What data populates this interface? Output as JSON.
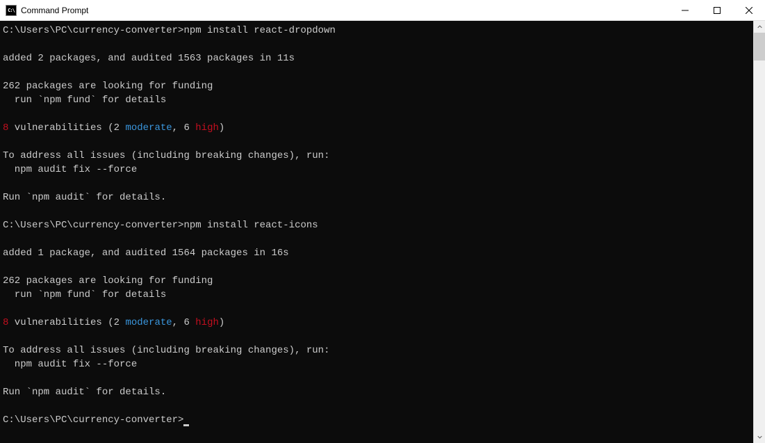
{
  "window": {
    "title": "Command Prompt",
    "icon_text": "C:\\"
  },
  "terminal": {
    "lines": [
      {
        "segments": [
          {
            "text": "C:\\Users\\PC\\currency-converter>npm install react-dropdown"
          }
        ]
      },
      {
        "segments": []
      },
      {
        "segments": [
          {
            "text": "added 2 packages, and audited 1563 packages in 11s"
          }
        ]
      },
      {
        "segments": []
      },
      {
        "segments": [
          {
            "text": "262 packages are looking for funding"
          }
        ]
      },
      {
        "segments": [
          {
            "text": "  run `npm fund` for details"
          }
        ]
      },
      {
        "segments": []
      },
      {
        "segments": [
          {
            "text": "8",
            "class": "red"
          },
          {
            "text": " vulnerabilities (2 "
          },
          {
            "text": "moderate",
            "class": "cyan"
          },
          {
            "text": ", 6 "
          },
          {
            "text": "high",
            "class": "red"
          },
          {
            "text": ")"
          }
        ]
      },
      {
        "segments": []
      },
      {
        "segments": [
          {
            "text": "To address all issues (including breaking changes), run:"
          }
        ]
      },
      {
        "segments": [
          {
            "text": "  npm audit fix --force"
          }
        ]
      },
      {
        "segments": []
      },
      {
        "segments": [
          {
            "text": "Run `npm audit` for details."
          }
        ]
      },
      {
        "segments": []
      },
      {
        "segments": [
          {
            "text": "C:\\Users\\PC\\currency-converter>npm install react-icons"
          }
        ]
      },
      {
        "segments": []
      },
      {
        "segments": [
          {
            "text": "added 1 package, and audited 1564 packages in 16s"
          }
        ]
      },
      {
        "segments": []
      },
      {
        "segments": [
          {
            "text": "262 packages are looking for funding"
          }
        ]
      },
      {
        "segments": [
          {
            "text": "  run `npm fund` for details"
          }
        ]
      },
      {
        "segments": []
      },
      {
        "segments": [
          {
            "text": "8",
            "class": "red"
          },
          {
            "text": " vulnerabilities (2 "
          },
          {
            "text": "moderate",
            "class": "cyan"
          },
          {
            "text": ", 6 "
          },
          {
            "text": "high",
            "class": "red"
          },
          {
            "text": ")"
          }
        ]
      },
      {
        "segments": []
      },
      {
        "segments": [
          {
            "text": "To address all issues (including breaking changes), run:"
          }
        ]
      },
      {
        "segments": [
          {
            "text": "  npm audit fix --force"
          }
        ]
      },
      {
        "segments": []
      },
      {
        "segments": [
          {
            "text": "Run `npm audit` for details."
          }
        ]
      },
      {
        "segments": []
      },
      {
        "segments": [
          {
            "text": "C:\\Users\\PC\\currency-converter>"
          }
        ],
        "cursor": true
      }
    ]
  }
}
